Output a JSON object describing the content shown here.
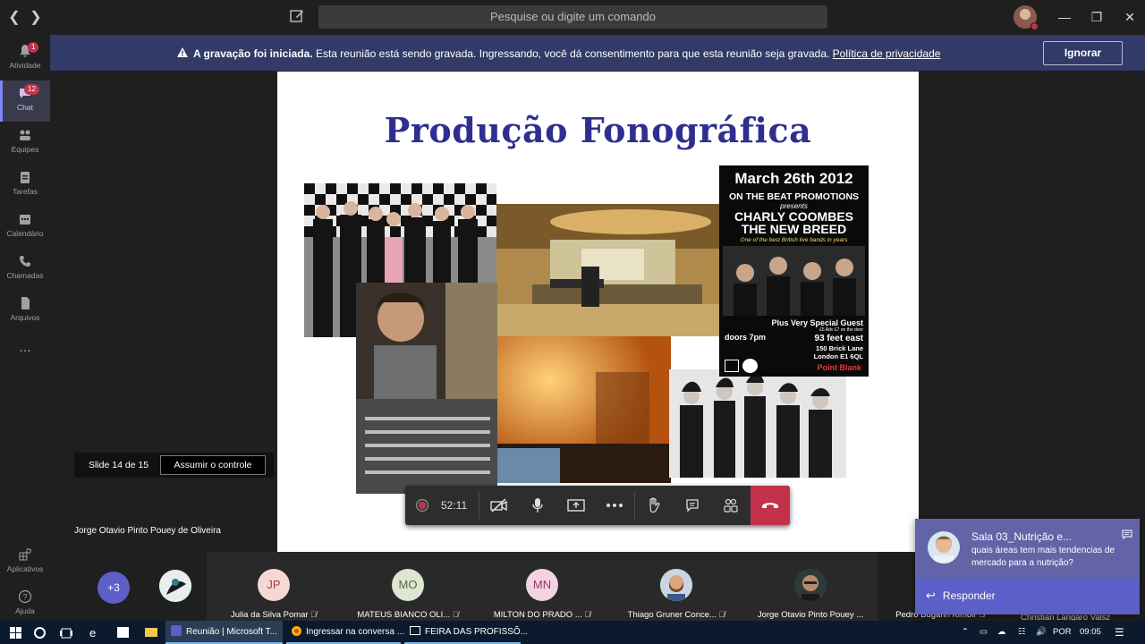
{
  "titlebar": {
    "search_placeholder": "Pesquise ou digite um comando"
  },
  "rail": {
    "items": [
      {
        "label": "Atividade",
        "badge": "1"
      },
      {
        "label": "Chat",
        "badge": "12"
      },
      {
        "label": "Equipes"
      },
      {
        "label": "Tarefas"
      },
      {
        "label": "Calendário"
      },
      {
        "label": "Chamadas"
      },
      {
        "label": "Arquivos"
      },
      {
        "label": "..."
      }
    ],
    "bottom": [
      {
        "label": "Aplicativos"
      },
      {
        "label": "Ajuda"
      }
    ]
  },
  "banner": {
    "bold": "A gravação foi iniciada.",
    "text": " Esta reunião está sendo gravada. Ingressando, você dá consentimento para que esta reunião seja gravada. ",
    "link": "Política de privacidade",
    "ignore": "Ignorar"
  },
  "slide": {
    "title": "Produção Fonográfica",
    "poster": {
      "date": "March 26th 2012",
      "promoter": "ON THE BEAT PROMOTIONS",
      "presents": "presents",
      "band1": "CHARLY COOMBES",
      "band2": "THE NEW BREED",
      "quote": "One of the best British live bands in years",
      "guest": "Plus Very Special Guest",
      "prices": "£5 Adv £7 on the door",
      "doors": "doors 7pm",
      "venue": "93 feet east",
      "address1": "150 Brick Lane",
      "address2": "London E1 6QL",
      "club": "Point Blank"
    }
  },
  "presentation": {
    "counter": "Slide 14 de 15",
    "take_control": "Assumir o controle",
    "presenter": "Jorge Otavio Pinto Pouey de Oliveira"
  },
  "controls": {
    "timer": "52:11"
  },
  "participants": {
    "overflow": "+3",
    "tiles": [
      {
        "initials": "JP",
        "name": "Julia da Silva Pomar",
        "bg": "#f4d8d3",
        "fg": "#a0453a"
      },
      {
        "initials": "MO",
        "name": "MATEUS BIANCO OLI...",
        "bg": "#dde6d0",
        "fg": "#5a6b40"
      },
      {
        "initials": "MN",
        "name": "MILTON DO PRADO ...",
        "bg": "#f2d3e2",
        "fg": "#9a3a6a"
      },
      {
        "initials": "",
        "name": "Thiago Gruner Conce..."
      },
      {
        "initials": "",
        "name": "Jorge Otavio Pinto Pouey ..."
      },
      {
        "initials": "",
        "name": "Pedro Bugarin Kimoir"
      },
      {
        "initials": "",
        "name": "Christian Langaro Valsz"
      }
    ]
  },
  "notification": {
    "title": "Sala 03_Nutrição e...",
    "body": "quais áreas tem mais tendencias de mercado para a nutrição?",
    "reply": "Responder"
  },
  "taskbar": {
    "apps": [
      {
        "label": "Reunião | Microsoft T..."
      },
      {
        "label": "Ingressar na conversa ..."
      },
      {
        "label": "FEIRA DAS PROFISSÕ..."
      }
    ],
    "lang": "POR",
    "time": "09:05"
  }
}
